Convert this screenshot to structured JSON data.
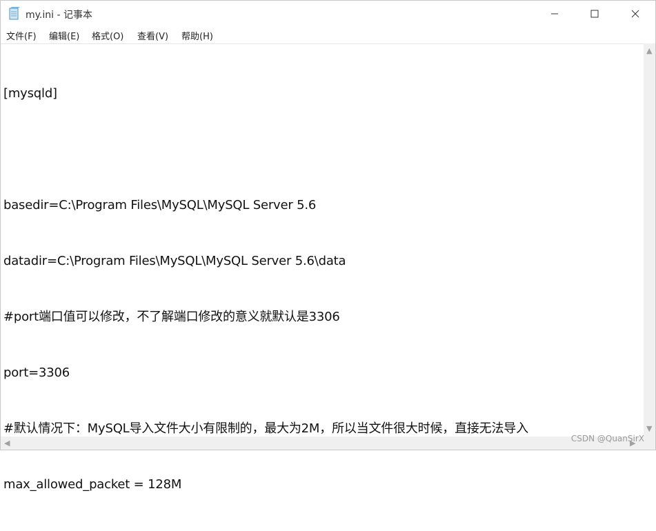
{
  "window": {
    "title": "my.ini - 记事本",
    "controls": {
      "minimize_icon": "minimize-icon",
      "maximize_icon": "maximize-icon",
      "close_icon": "close-icon"
    }
  },
  "menubar": {
    "items": [
      "文件(F)",
      "编辑(E)",
      "格式(O)",
      "查看(V)",
      "帮助(H)"
    ]
  },
  "editor": {
    "lines": [
      "[mysqld]",
      "",
      "basedir=C:\\Program Files\\MySQL\\MySQL Server 5.6",
      "datadir=C:\\Program Files\\MySQL\\MySQL Server 5.6\\data",
      "#port端口值可以修改，不了解端口修改的意义就默认是3306",
      "port=3306",
      "#默认情况下：MySQL导入文件大小有限制的，最大为2M，所以当文件很大时候，直接无法导入",
      "max_allowed_packet = 128M"
    ]
  },
  "watermark": "CSDN @QuanSirX"
}
